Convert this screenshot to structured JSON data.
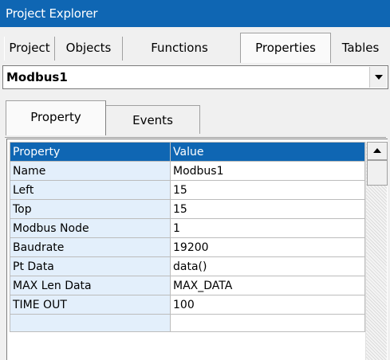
{
  "window": {
    "title": "Project Explorer"
  },
  "main_tabs": [
    {
      "label": "Project",
      "active": false
    },
    {
      "label": "Objects",
      "active": false
    },
    {
      "label": "Functions",
      "active": false
    },
    {
      "label": "Properties",
      "active": true
    },
    {
      "label": "Tables",
      "active": false
    }
  ],
  "object_selector": {
    "value": "Modbus1",
    "icon": "chevron-down-icon"
  },
  "sub_tabs": [
    {
      "label": "Property",
      "active": true
    },
    {
      "label": "Events",
      "active": false
    }
  ],
  "grid": {
    "headers": [
      "Property",
      "Value"
    ],
    "rows": [
      [
        "Name",
        "Modbus1"
      ],
      [
        "Left",
        "15"
      ],
      [
        "Top",
        "15"
      ],
      [
        "Modbus Node",
        "1"
      ],
      [
        "Baudrate",
        "19200"
      ],
      [
        "Pt Data",
        "data()"
      ],
      [
        "MAX Len Data",
        "MAX_DATA"
      ],
      [
        "TIME OUT",
        "100"
      ]
    ]
  },
  "colors": {
    "accent": "#0f66b3",
    "property_column": "#e3effb"
  }
}
